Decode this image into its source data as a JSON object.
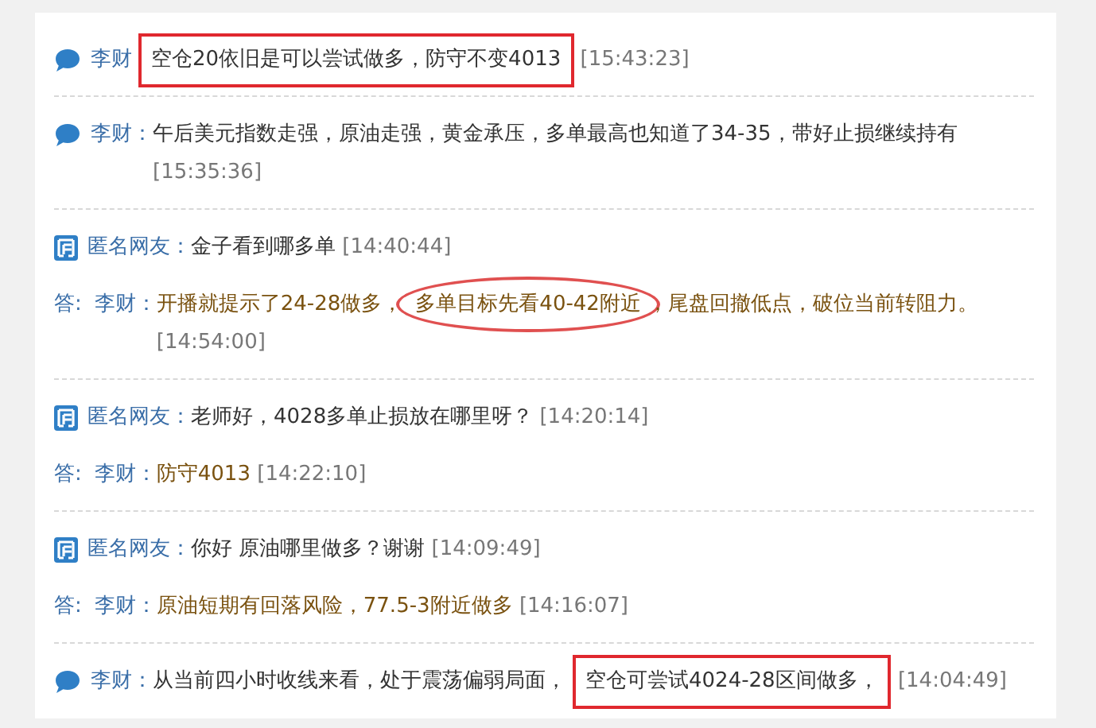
{
  "groups": [
    {
      "lines": [
        {
          "kind": "message",
          "name": "李财",
          "segments": [
            {
              "text": "空仓20依旧是可以尝试做多，防守不变4013",
              "boxed": true,
              "circled": false
            }
          ],
          "time": "[15:43:23]"
        }
      ]
    },
    {
      "lines": [
        {
          "kind": "message",
          "name": "李财：",
          "segments": [
            {
              "text": "午后美元指数走强，原油走强，黄金承压，多单最高也知道了34-35，带好止损继续持有",
              "boxed": false,
              "circled": false
            }
          ],
          "time": "[15:35:36]"
        }
      ]
    },
    {
      "lines": [
        {
          "kind": "question",
          "name": "匿名网友：",
          "segments": [
            {
              "text": "金子看到哪多单",
              "boxed": false,
              "circled": false
            }
          ],
          "time": "[14:40:44]"
        },
        {
          "kind": "answer",
          "prefix": "答:",
          "name": "李财：",
          "segments": [
            {
              "text": "开播就提示了24-28做多，",
              "boxed": false,
              "circled": false
            },
            {
              "text": "多单目标先看40-42附近",
              "boxed": false,
              "circled": true
            },
            {
              "text": "，尾盘回撤低点，破位当前转阻力。",
              "boxed": false,
              "circled": false
            }
          ],
          "time": "[14:54:00]"
        }
      ]
    },
    {
      "lines": [
        {
          "kind": "question",
          "name": "匿名网友：",
          "segments": [
            {
              "text": "老师好，4028多单止损放在哪里呀？",
              "boxed": false,
              "circled": false
            }
          ],
          "time": "[14:20:14]"
        },
        {
          "kind": "answer",
          "prefix": "答:",
          "name": "李财：",
          "segments": [
            {
              "text": "防守4013",
              "boxed": false,
              "circled": false
            }
          ],
          "time": "[14:22:10]"
        }
      ]
    },
    {
      "lines": [
        {
          "kind": "question",
          "name": "匿名网友：",
          "segments": [
            {
              "text": "你好 原油哪里做多？谢谢",
              "boxed": false,
              "circled": false
            }
          ],
          "time": "[14:09:49]"
        },
        {
          "kind": "answer",
          "prefix": "答:",
          "name": "李财：",
          "segments": [
            {
              "text": "原油短期有回落风险，77.5-3附近做多",
              "boxed": false,
              "circled": false
            }
          ],
          "time": "[14:16:07]"
        }
      ]
    },
    {
      "lines": [
        {
          "kind": "message",
          "name": "李财：",
          "segments": [
            {
              "text": "从当前四小时收线来看，处于震荡偏弱局面，",
              "boxed": false,
              "circled": false
            },
            {
              "text": "空仓可尝试4024-28区间做多，",
              "boxed": true,
              "circled": false
            }
          ],
          "time": "[14:04:49]"
        }
      ]
    }
  ]
}
